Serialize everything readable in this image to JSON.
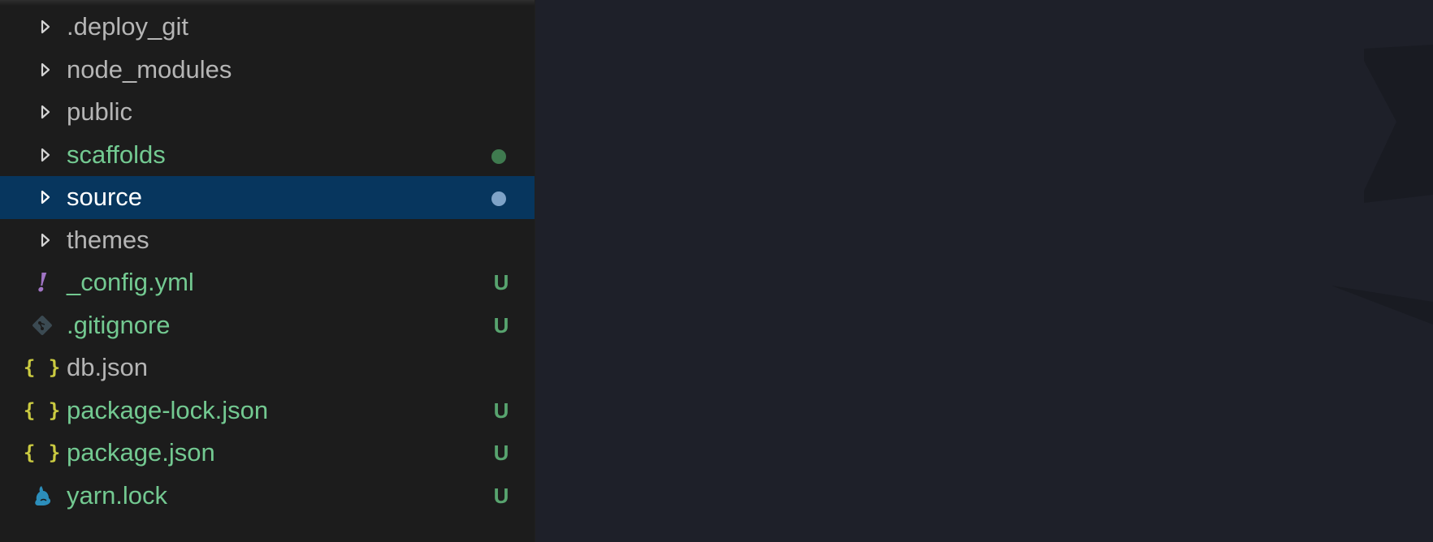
{
  "explorer": {
    "items": [
      {
        "name": ".deploy_git",
        "kind": "folder",
        "status": "",
        "icon": "chevron-right-icon"
      },
      {
        "name": "node_modules",
        "kind": "folder",
        "status": "",
        "icon": "chevron-right-icon"
      },
      {
        "name": "public",
        "kind": "folder",
        "status": "",
        "icon": "chevron-right-icon"
      },
      {
        "name": "scaffolds",
        "kind": "folder",
        "status": "modified-dot",
        "icon": "chevron-right-icon"
      },
      {
        "name": "source",
        "kind": "folder",
        "status": "modified-dot",
        "icon": "chevron-right-icon",
        "selected": true
      },
      {
        "name": "themes",
        "kind": "folder",
        "status": "",
        "icon": "chevron-right-icon"
      },
      {
        "name": "_config.yml",
        "kind": "file",
        "status": "U",
        "icon": "yaml-icon"
      },
      {
        "name": ".gitignore",
        "kind": "file",
        "status": "U",
        "icon": "git-icon"
      },
      {
        "name": "db.json",
        "kind": "file",
        "status": "",
        "icon": "json-icon"
      },
      {
        "name": "package-lock.json",
        "kind": "file",
        "status": "U",
        "icon": "json-icon"
      },
      {
        "name": "package.json",
        "kind": "file",
        "status": "U",
        "icon": "json-icon"
      },
      {
        "name": "yarn.lock",
        "kind": "file",
        "status": "U",
        "icon": "yarn-icon"
      }
    ]
  },
  "icons": {
    "json_glyph": "{ }",
    "yaml_glyph": "!"
  },
  "colors": {
    "sidebar_bg": "#1c1c1c",
    "editor_bg": "#1e2029",
    "selection_bg": "#07365e",
    "git_added_text": "#73c991",
    "git_untracked_badge": "#58a46f",
    "json_icon": "#cbcb41",
    "yaml_icon": "#a074c4",
    "yarn_icon": "#2c8ebb"
  }
}
